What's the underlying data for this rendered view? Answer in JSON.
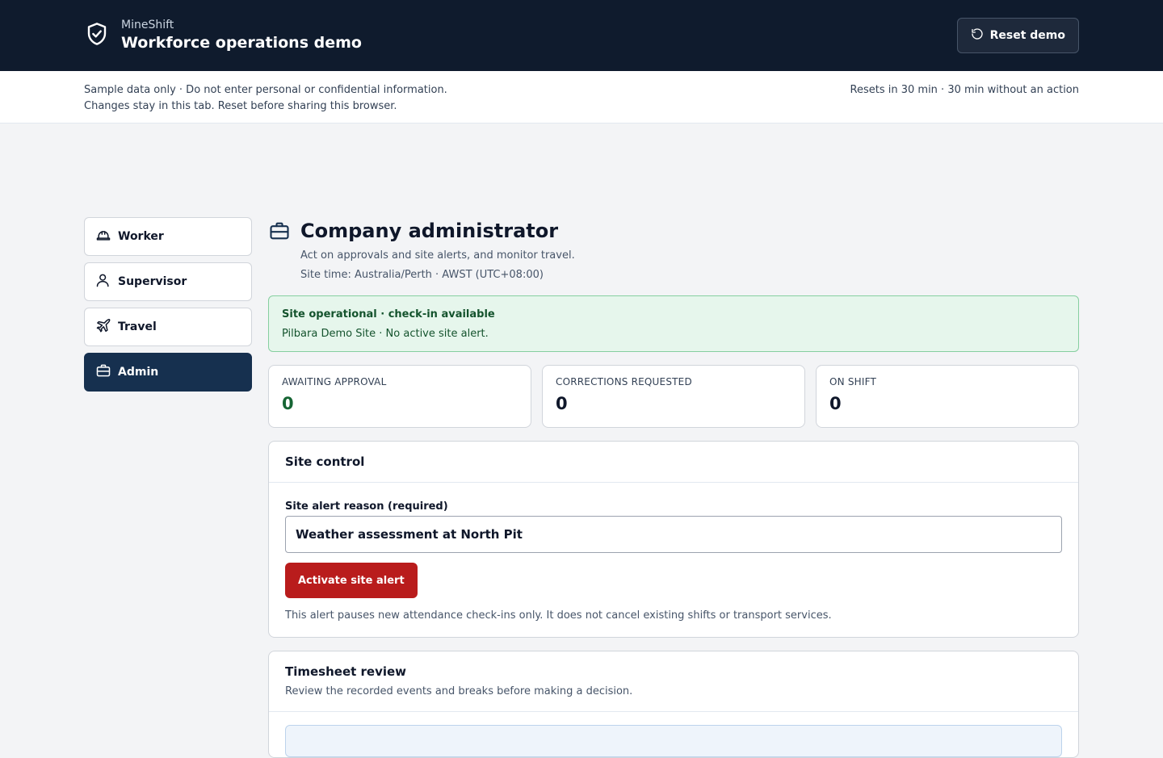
{
  "header": {
    "brand_name": "MineShift",
    "title": "Workforce operations demo",
    "reset_label": "Reset demo"
  },
  "notice": {
    "line1": "Sample data only · Do not enter personal or confidential information.",
    "line2": "Changes stay in this tab. Reset before sharing this browser.",
    "reset_timer": "Resets in 30 min · 30 min without an action"
  },
  "sidebar": {
    "items": [
      {
        "label": "Worker",
        "icon": "hard-hat-icon",
        "active": false
      },
      {
        "label": "Supervisor",
        "icon": "user-icon",
        "active": false
      },
      {
        "label": "Travel",
        "icon": "plane-icon",
        "active": false
      },
      {
        "label": "Admin",
        "icon": "briefcase-icon",
        "active": true
      }
    ]
  },
  "page": {
    "title": "Company administrator",
    "description": "Act on approvals and site alerts, and monitor travel.",
    "site_time": "Site time: Australia/Perth · AWST (UTC+08:00)"
  },
  "status": {
    "title": "Site operational · check-in available",
    "text": "Pilbara Demo Site · No active site alert."
  },
  "stats": [
    {
      "label": "AWAITING APPROVAL",
      "value": "0"
    },
    {
      "label": "CORRECTIONS REQUESTED",
      "value": "0"
    },
    {
      "label": "ON SHIFT",
      "value": "0"
    }
  ],
  "site_control": {
    "title": "Site control",
    "field_label": "Site alert reason (required)",
    "field_value": "Weather assessment at North Pit",
    "button_label": "Activate site alert",
    "hint": "This alert pauses new attendance check-ins only. It does not cancel existing shifts or transport services."
  },
  "timesheet": {
    "title": "Timesheet review",
    "subtitle": "Review the recorded events and breaks before making a decision."
  },
  "colors": {
    "header_bg": "#0f1b2d",
    "active_nav": "#16304f",
    "danger": "#b91c1c",
    "success_bg": "#e6f6ec"
  }
}
